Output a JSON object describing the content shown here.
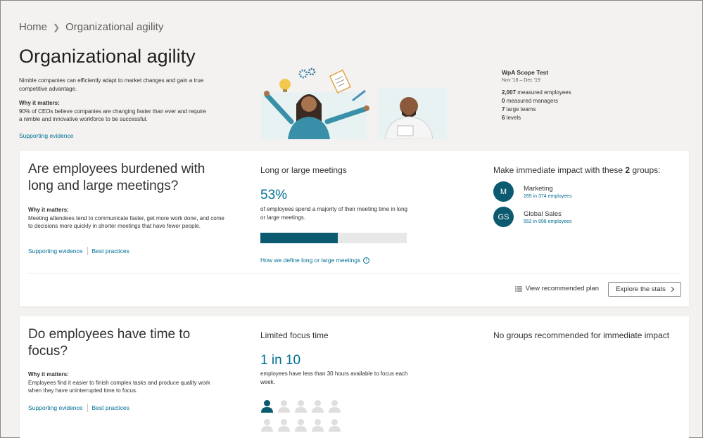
{
  "breadcrumb": {
    "home": "Home",
    "separator": ">",
    "current": "Organizational agility"
  },
  "page": {
    "title": "Organizational agility",
    "intro": "Nimble companies can efficiently adapt to market changes and gain a true competitive advantage.",
    "why_heading": "Why it matters:",
    "why_text": "90% of CEOs believe companies are changing faster than ever and require a nimble and innovative workforce to be successful.",
    "supporting_link": "Supporting evidence"
  },
  "scope": {
    "title": "WpA Scope Test",
    "dates": "Nov '18 – Dec '19",
    "stats": [
      {
        "value": "2,007",
        "label": "measured employees"
      },
      {
        "value": "0",
        "label": "measured managers"
      },
      {
        "value": "7",
        "label": "large teams"
      },
      {
        "value": "6",
        "label": "levels"
      }
    ]
  },
  "card1": {
    "question": "Are employees burdened with long and large meetings?",
    "why_heading": "Why it matters:",
    "why_text": "Meeting attendees tend to communicate faster, get more work done, and come to decisions more quickly in shorter meetings that have fewer people.",
    "link_evidence": "Supporting evidence",
    "link_practices": "Best practices",
    "metric_label": "Long or large meetings",
    "metric_value": "53%",
    "metric_fraction": 0.53,
    "metric_desc": "of employees spend a majority of their meeting time in long or large meetings.",
    "define_link": "How we define long or large meetings",
    "info_icon": "i",
    "groups_title_prefix": "Make immediate impact with these",
    "groups_count": "2",
    "groups_title_suffix": "groups:",
    "groups": [
      {
        "initials": "M",
        "name": "Marketing",
        "count": "265 in 374 employees"
      },
      {
        "initials": "GS",
        "name": "Global Sales",
        "count": "552 in 898 employees"
      }
    ],
    "view_plan": "View recommended plan",
    "explore": "Explore the stats"
  },
  "card2": {
    "question": "Do employees have time to focus?",
    "why_heading": "Why it matters:",
    "why_text": "Employees find it easier to finish complex tasks and produce quality work when they have uninterrupted time to focus.",
    "link_evidence": "Supporting evidence",
    "link_practices": "Best practices",
    "metric_label": "Limited focus time",
    "metric_value": "1 in 10",
    "metric_desc": "employees have less than 30 hours available to focus each week.",
    "highlighted_people": 1,
    "total_people": 10,
    "groups_title": "No groups recommended for immediate impact"
  },
  "colors": {
    "accent": "#006f94",
    "dark_teal": "#0b5a6f",
    "background": "#f3f2f1"
  }
}
